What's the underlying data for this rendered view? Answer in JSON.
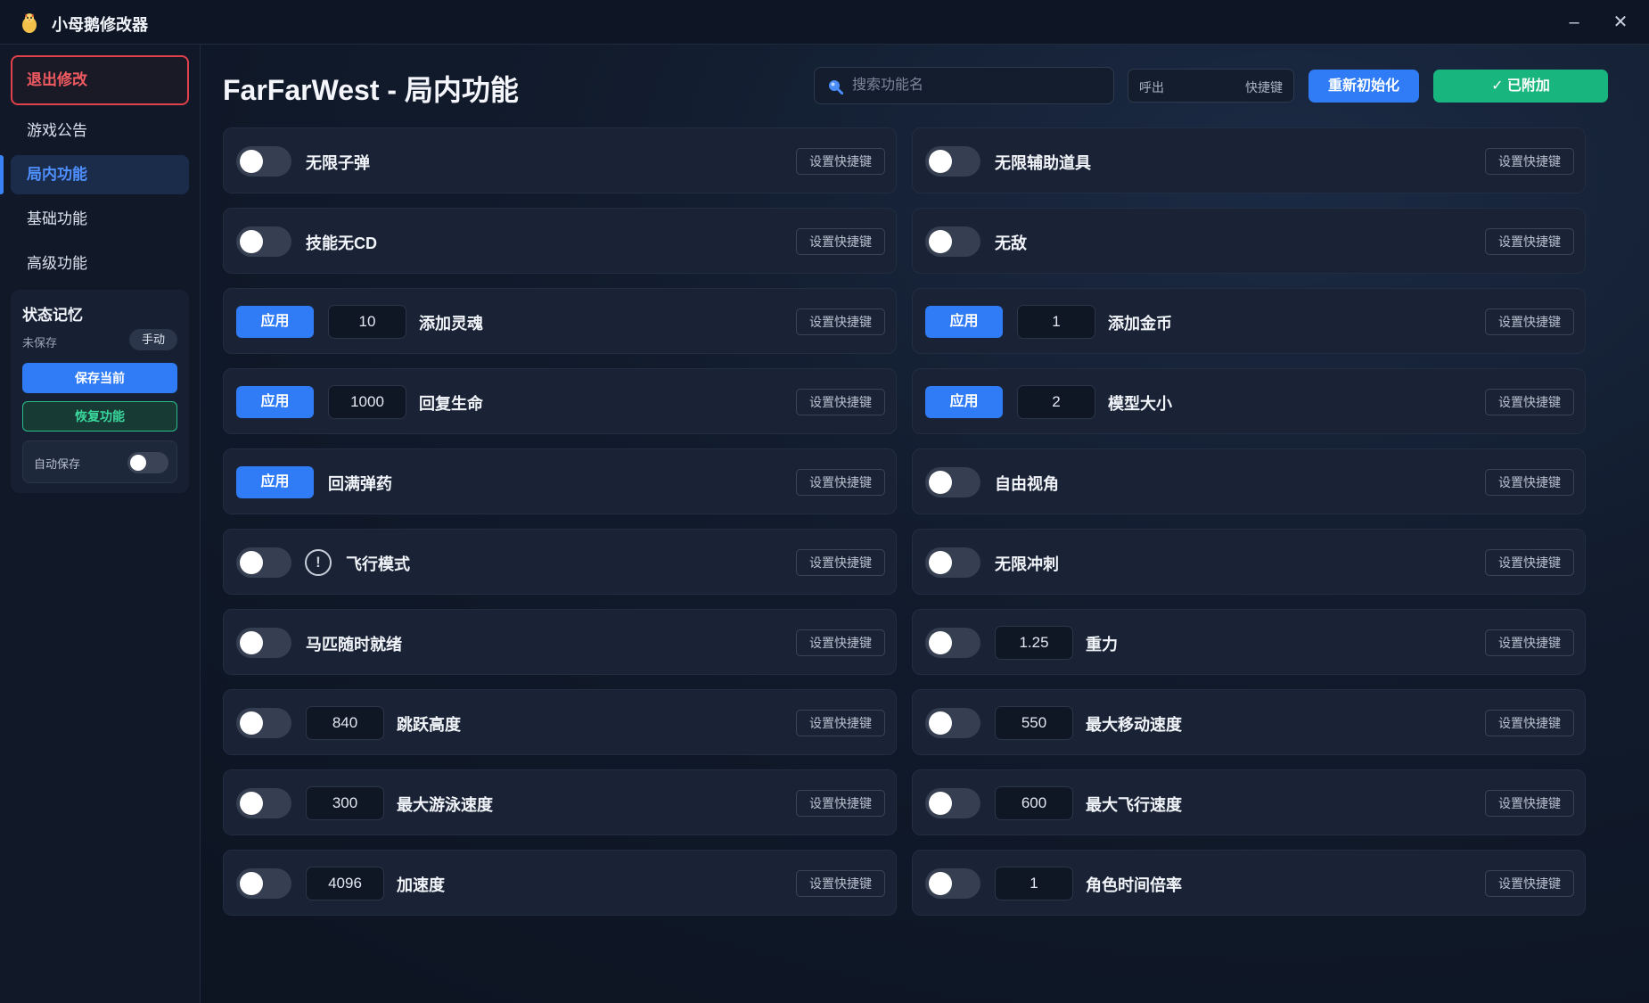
{
  "app": {
    "title": "小母鹅修改器",
    "minimize_glyph": "–",
    "close_glyph": "✕"
  },
  "sidebar": {
    "exit_label": "退出修改",
    "items": [
      {
        "label": "游戏公告"
      },
      {
        "label": "局内功能"
      },
      {
        "label": "基础功能"
      },
      {
        "label": "高级功能"
      }
    ],
    "memory": {
      "title": "状态记忆",
      "status": "未保存",
      "mode": "手动",
      "save_label": "保存当前",
      "restore_label": "恢复功能",
      "autosave_label": "自动保存"
    }
  },
  "header": {
    "title": "FarFarWest - 局内功能",
    "search_placeholder": "搜索功能名",
    "hotkey_value": "呼出",
    "hotkey_label": "快捷键",
    "reinit_label": "重新初始化",
    "attached_label": "✓ 已附加"
  },
  "common": {
    "apply_label": "应用",
    "hotkey_btn": "设置快捷键",
    "warn_glyph": "!"
  },
  "left": [
    {
      "label": "无限子弹"
    },
    {
      "label": "技能无CD"
    },
    {
      "label": "添加灵魂",
      "value": "10"
    },
    {
      "label": "回复生命",
      "value": "1000"
    },
    {
      "label": "回满弹药"
    },
    {
      "label": "飞行模式"
    },
    {
      "label": "马匹随时就绪"
    },
    {
      "label": "跳跃高度",
      "value": "840"
    },
    {
      "label": "最大游泳速度",
      "value": "300"
    },
    {
      "label": "加速度",
      "value": "4096"
    }
  ],
  "right": [
    {
      "label": "无限辅助道具"
    },
    {
      "label": "无敌"
    },
    {
      "label": "添加金币",
      "value": "1"
    },
    {
      "label": "模型大小",
      "value": "2"
    },
    {
      "label": "自由视角"
    },
    {
      "label": "无限冲刺"
    },
    {
      "label": "重力",
      "value": "1.25"
    },
    {
      "label": "最大移动速度",
      "value": "550"
    },
    {
      "label": "最大飞行速度",
      "value": "600"
    },
    {
      "label": "角色时间倍率",
      "value": "1"
    }
  ],
  "colors": {
    "accent_blue": "#2f7cf6",
    "success_green": "#19b57e",
    "danger_red": "#e0414a"
  }
}
